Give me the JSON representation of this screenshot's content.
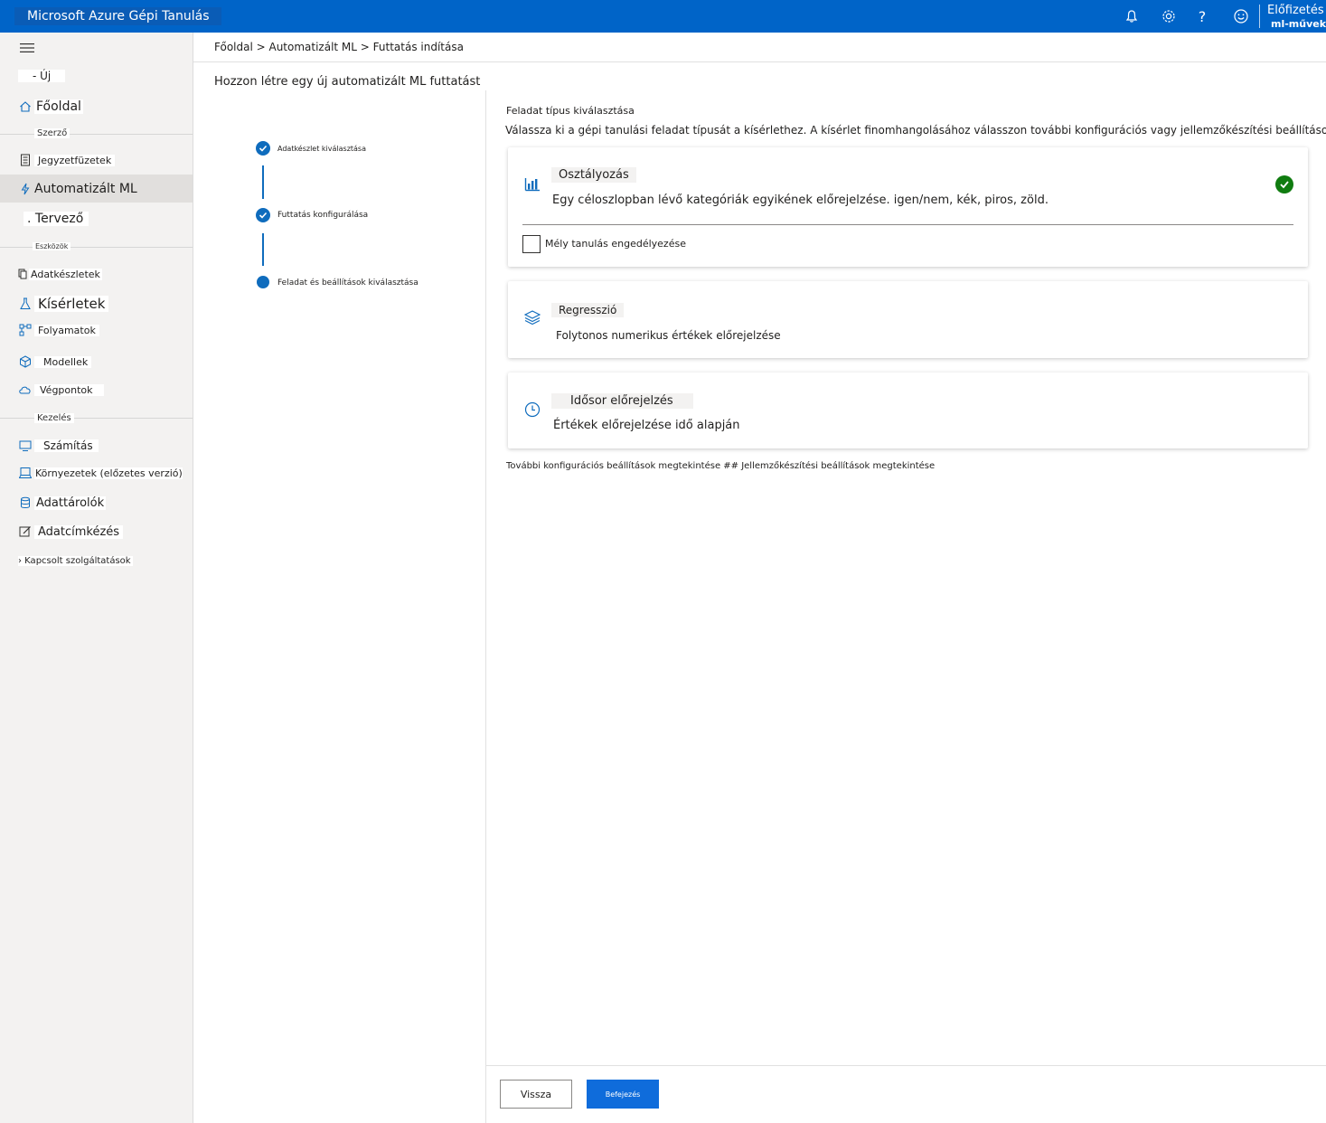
{
  "topbar": {
    "app_title": "Microsoft Azure Gépi Tanulás",
    "subscription_label": "Előfizetés",
    "subscription_value": "ml-művekp",
    "icons": [
      "bell-icon",
      "gear-icon",
      "help-icon",
      "smiley-icon"
    ]
  },
  "sidebar": {
    "menu_icon": "hamburger-icon",
    "new_label": "- Új",
    "home_label": "Főoldal",
    "section_author": "Szerző",
    "notebooks_label": "Jegyzetfüzetek",
    "automl_label": "Automatizált ML",
    "designer_label": ". Tervező",
    "section_assets": "Eszközök",
    "datasets_label": "Adatkészletek",
    "experiments_label": "Kísérletek",
    "pipelines_label": "Folyamatok",
    "models_label": "Modellek",
    "endpoints_label": "Végpontok",
    "section_manage": "Kezelés",
    "compute_label": "Számítás",
    "environments_label": "Környezetek (előzetes verzió)",
    "datastores_label": "Adattárolók",
    "labeling_label": "Adatcímkézés",
    "linked_label": "› Kapcsolt szolgáltatások"
  },
  "breadcrumb": "Főoldal > Automatizált ML > Futtatás indítása",
  "page_title": "Hozzon létre egy új automatizált ML futtatást",
  "steps": [
    {
      "label": "Adatkészlet kiválasztása",
      "state": "done"
    },
    {
      "label": "Futtatás konfigurálása",
      "state": "done"
    },
    {
      "label": "Feladat és beállítások kiválasztása",
      "state": "current"
    }
  ],
  "task": {
    "heading": "Feladat típus kiválasztása",
    "description": "Válassza ki a gépi tanulási feladat típusát a kísérlethez. A kísérlet finomhangolásához válasszon további konfigurációs vagy jellemzőkészítési beállításokat.",
    "options": [
      {
        "title": "Osztályozás",
        "description": "Egy céloszlopban lévő kategóriák egyikének előrejelzése. igen/nem, kék, piros, zöld.",
        "selected": true
      },
      {
        "title": "Regresszió",
        "description": "Folytonos numerikus értékek előrejelzése",
        "selected": false
      },
      {
        "title": "Idősor előrejelzés",
        "description": "Értékek előrejelzése idő alapján",
        "selected": false
      }
    ],
    "deep_learning_label": "Mély tanulás engedélyezése",
    "more_settings": "További konfigurációs beállítások megtekintése ## Jellemzőkészítési beállítások megtekintése"
  },
  "footer": {
    "back_label": "Vissza",
    "finish_label": "Befejezés"
  },
  "colors": {
    "topbar": "#0064c8",
    "accent": "#0f6cbd",
    "success": "#107c10"
  }
}
